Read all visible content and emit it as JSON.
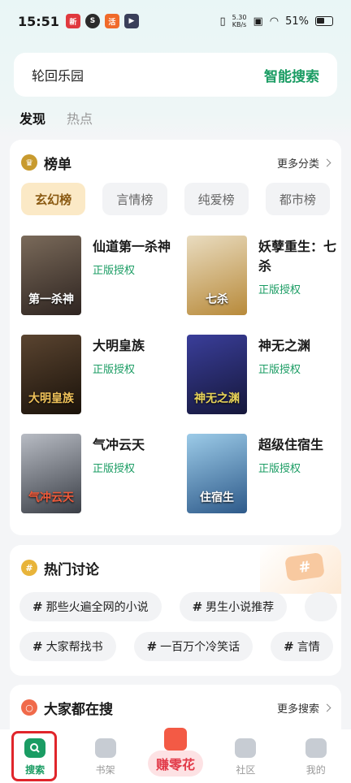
{
  "status_bar": {
    "time": "15:51",
    "net_speed_value": "5.30",
    "net_speed_unit": "KB/s",
    "battery": "51%"
  },
  "search": {
    "value": "轮回乐园",
    "submit_label": "智能搜索"
  },
  "tabs": [
    {
      "label": "发现",
      "active": true
    },
    {
      "label": "热点",
      "active": false
    }
  ],
  "ranking": {
    "title": "榜单",
    "more_label": "更多分类",
    "categories": [
      {
        "label": "玄幻榜",
        "active": true
      },
      {
        "label": "言情榜",
        "active": false
      },
      {
        "label": "纯爱榜",
        "active": false
      },
      {
        "label": "都市榜",
        "active": false
      }
    ],
    "books": [
      {
        "title": "仙道第一杀神",
        "tag": "正版授权",
        "cover_text": "第一杀神",
        "cover_color": "#4a3a2e"
      },
      {
        "title": "妖孽重生：七杀",
        "tag": "正版授权",
        "cover_text": "七杀",
        "cover_color": "#c9b07a"
      },
      {
        "title": "大明皇族",
        "tag": "正版授权",
        "cover_text": "大明皇族",
        "cover_color": "#3a2818"
      },
      {
        "title": "神无之渊",
        "tag": "正版授权",
        "cover_text": "神无之渊",
        "cover_color": "#2a2e7a"
      },
      {
        "title": "气冲云天",
        "tag": "正版授权",
        "cover_text": "气冲云天",
        "cover_color": "#6a6f78"
      },
      {
        "title": "超级住宿生",
        "tag": "正版授权",
        "cover_text": "住宿生",
        "cover_color": "#4f86b8"
      }
    ]
  },
  "hot_discussion": {
    "title": "热门讨论",
    "row1": [
      "那些火遍全网的小说",
      "男生小说推荐"
    ],
    "row2": [
      "大家帮找书",
      "一百万个冷笑话",
      "言情"
    ]
  },
  "everyone_searching": {
    "title": "大家都在搜",
    "more_label": "更多搜索"
  },
  "bottom_nav": {
    "search": "搜索",
    "bookshelf": "书架",
    "earn": "赚零花",
    "community": "社区",
    "mine": "我的"
  }
}
